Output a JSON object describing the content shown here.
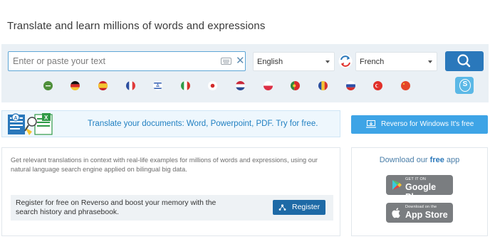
{
  "headline": "Translate and learn millions of words and expressions",
  "search": {
    "placeholder": "Enter or paste your text",
    "value": "",
    "source_language": "English",
    "target_language": "French"
  },
  "flags": [
    {
      "name": "arabic-flag-icon"
    },
    {
      "name": "german-flag-icon"
    },
    {
      "name": "spanish-flag-icon"
    },
    {
      "name": "french-flag-icon"
    },
    {
      "name": "hebrew-flag-icon"
    },
    {
      "name": "italian-flag-icon"
    },
    {
      "name": "japanese-flag-icon"
    },
    {
      "name": "dutch-flag-icon"
    },
    {
      "name": "polish-flag-icon"
    },
    {
      "name": "portuguese-flag-icon"
    },
    {
      "name": "romanian-flag-icon"
    },
    {
      "name": "russian-flag-icon"
    },
    {
      "name": "turkish-flag-icon"
    },
    {
      "name": "chinese-flag-icon"
    }
  ],
  "documents_banner": {
    "text": "Translate your documents: Word, Powerpoint, PDF. Try for free."
  },
  "windows_button": {
    "label": "Reverso for Windows It's free"
  },
  "info": {
    "text": "Get relevant translations in context with real-life examples for millions of words and expressions, using our natural language search engine applied on bilingual big data.",
    "register_text": "Register for free on Reverso and boost your memory with the search history and phrasebook.",
    "register_label": "Register"
  },
  "app": {
    "title_prefix": "Download our ",
    "title_emphasis": "free",
    "title_suffix": " app",
    "google_play_small": "GET IT ON",
    "google_play_big": "Google Play",
    "app_store_small": "Download on the",
    "app_store_big": "App Store"
  },
  "colors": {
    "accent": "#2a78bb",
    "windows_button": "#3ea4e6",
    "register_button": "#1e6aa6",
    "search_area": "#eaf0f5"
  }
}
